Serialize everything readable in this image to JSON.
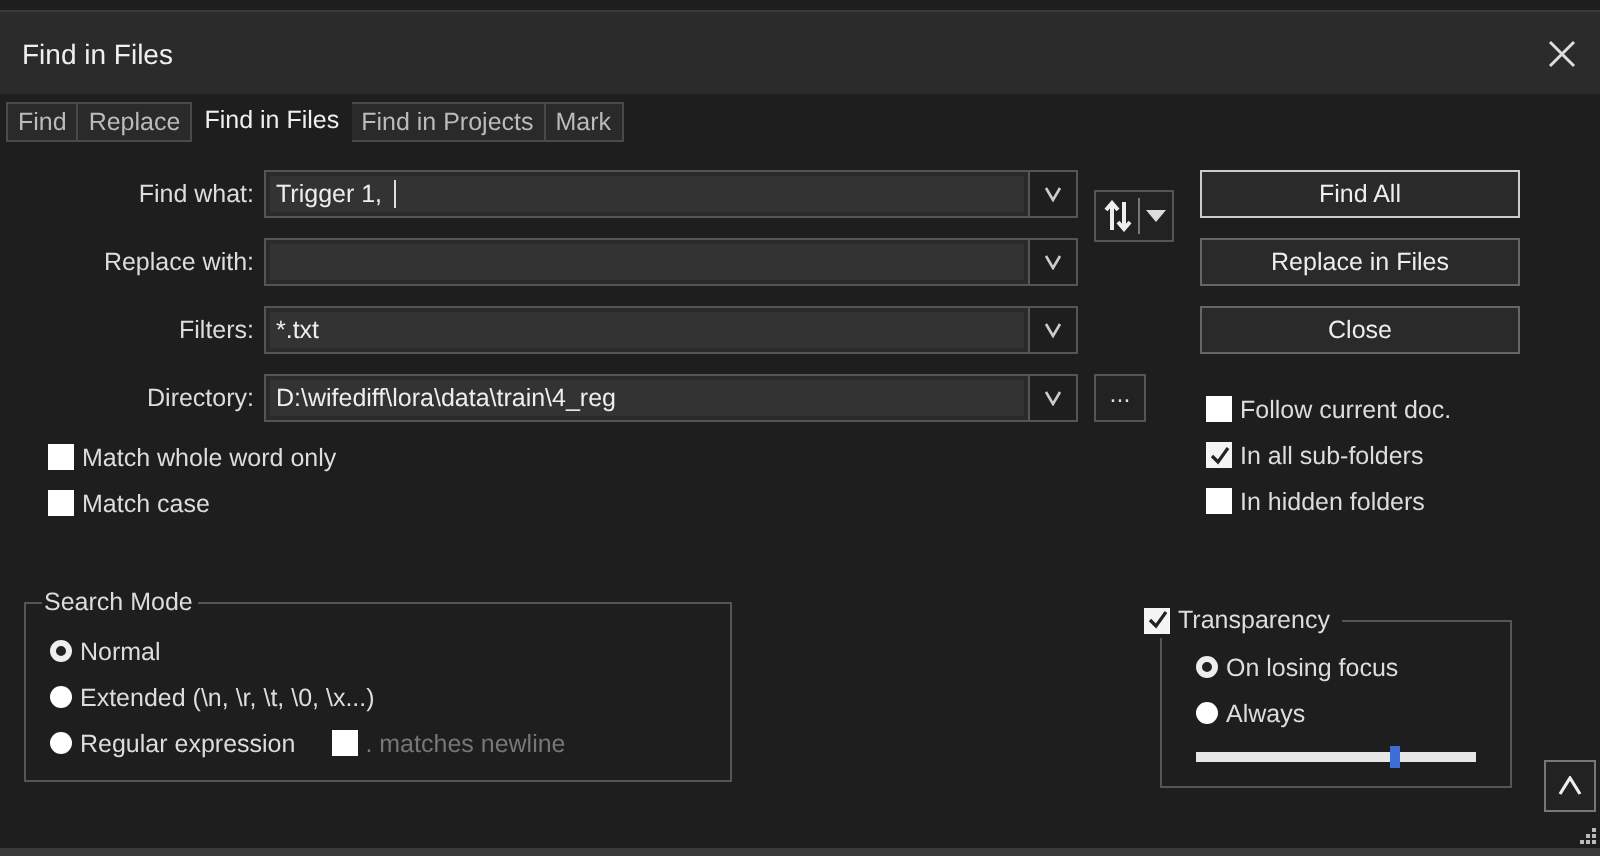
{
  "window": {
    "title": "Find in Files"
  },
  "tabs": [
    {
      "label": "Find",
      "selected": false
    },
    {
      "label": "Replace",
      "selected": false
    },
    {
      "label": "Find in Files",
      "selected": true
    },
    {
      "label": "Find in Projects",
      "selected": false
    },
    {
      "label": "Mark",
      "selected": false
    }
  ],
  "fields": [
    {
      "label": "Find what:",
      "value": "Trigger 1, "
    },
    {
      "label": "Replace with:"
    },
    {
      "label": "Filters:",
      "value": "*.txt"
    },
    {
      "label": "Directory:",
      "value": "D:\\wifediff\\lora\\data\\train\\4_reg",
      "browse": "..."
    }
  ],
  "buttons": [
    {
      "label": "Find All",
      "default": true
    },
    {
      "label": "Replace in Files",
      "default": false
    },
    {
      "label": "Close",
      "default": false
    }
  ],
  "left_options": [
    {
      "label": "Match whole word only",
      "checked": false
    },
    {
      "label": "Match case",
      "checked": false
    }
  ],
  "right_options": [
    {
      "label": "Follow current doc.",
      "checked": false
    },
    {
      "label": "In all sub-folders",
      "checked": true
    },
    {
      "label": "In hidden folders",
      "checked": false
    }
  ],
  "search_mode": {
    "title": "Search Mode",
    "options": [
      {
        "label": "Normal",
        "selected": true
      },
      {
        "label": "Extended (\\n, \\r, \\t, \\0, \\x...)",
        "selected": false
      },
      {
        "label": "Regular expression",
        "selected": false
      }
    ],
    "newline_option": {
      "label": ". matches newline",
      "checked": false,
      "disabled": true
    }
  },
  "transparency": {
    "label": "Transparency",
    "checked": true,
    "options": [
      {
        "label": "On losing focus",
        "selected": true
      },
      {
        "label": "Always",
        "selected": false
      }
    ],
    "level": 0.71
  }
}
